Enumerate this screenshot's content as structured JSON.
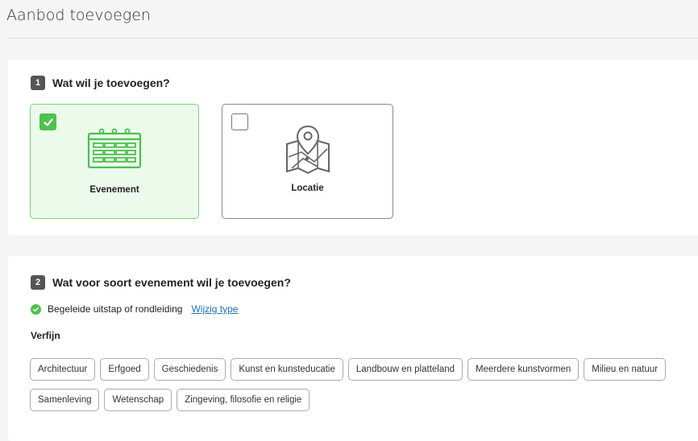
{
  "page": {
    "title": "Aanbod toevoegen"
  },
  "step1": {
    "number": "1",
    "title": "Wat wil je toevoegen?",
    "options": [
      {
        "label": "Evenement",
        "selected": true,
        "icon": "calendar-icon"
      },
      {
        "label": "Locatie",
        "selected": false,
        "icon": "map-pin-icon"
      }
    ]
  },
  "step2": {
    "number": "2",
    "title": "Wat voor soort evenement wil je toevoegen?",
    "selected_type": "Begeleide uitstap of rondleiding",
    "change_link": "Wijzig type",
    "refine_label": "Verfijn",
    "tags_row1": [
      "Architectuur",
      "Erfgoed",
      "Geschiedenis",
      "Kunst en kunsteducatie",
      "Landbouw en platteland",
      "Meerdere kunstvormen",
      "Milieu en natuur"
    ],
    "tags_row2": [
      "Samenleving",
      "Wetenschap",
      "Zingeving, filosofie en religie"
    ]
  },
  "colors": {
    "accent_green": "#4dc14d",
    "link_blue": "#1f6fb5",
    "selected_bg": "#ecfaec"
  }
}
